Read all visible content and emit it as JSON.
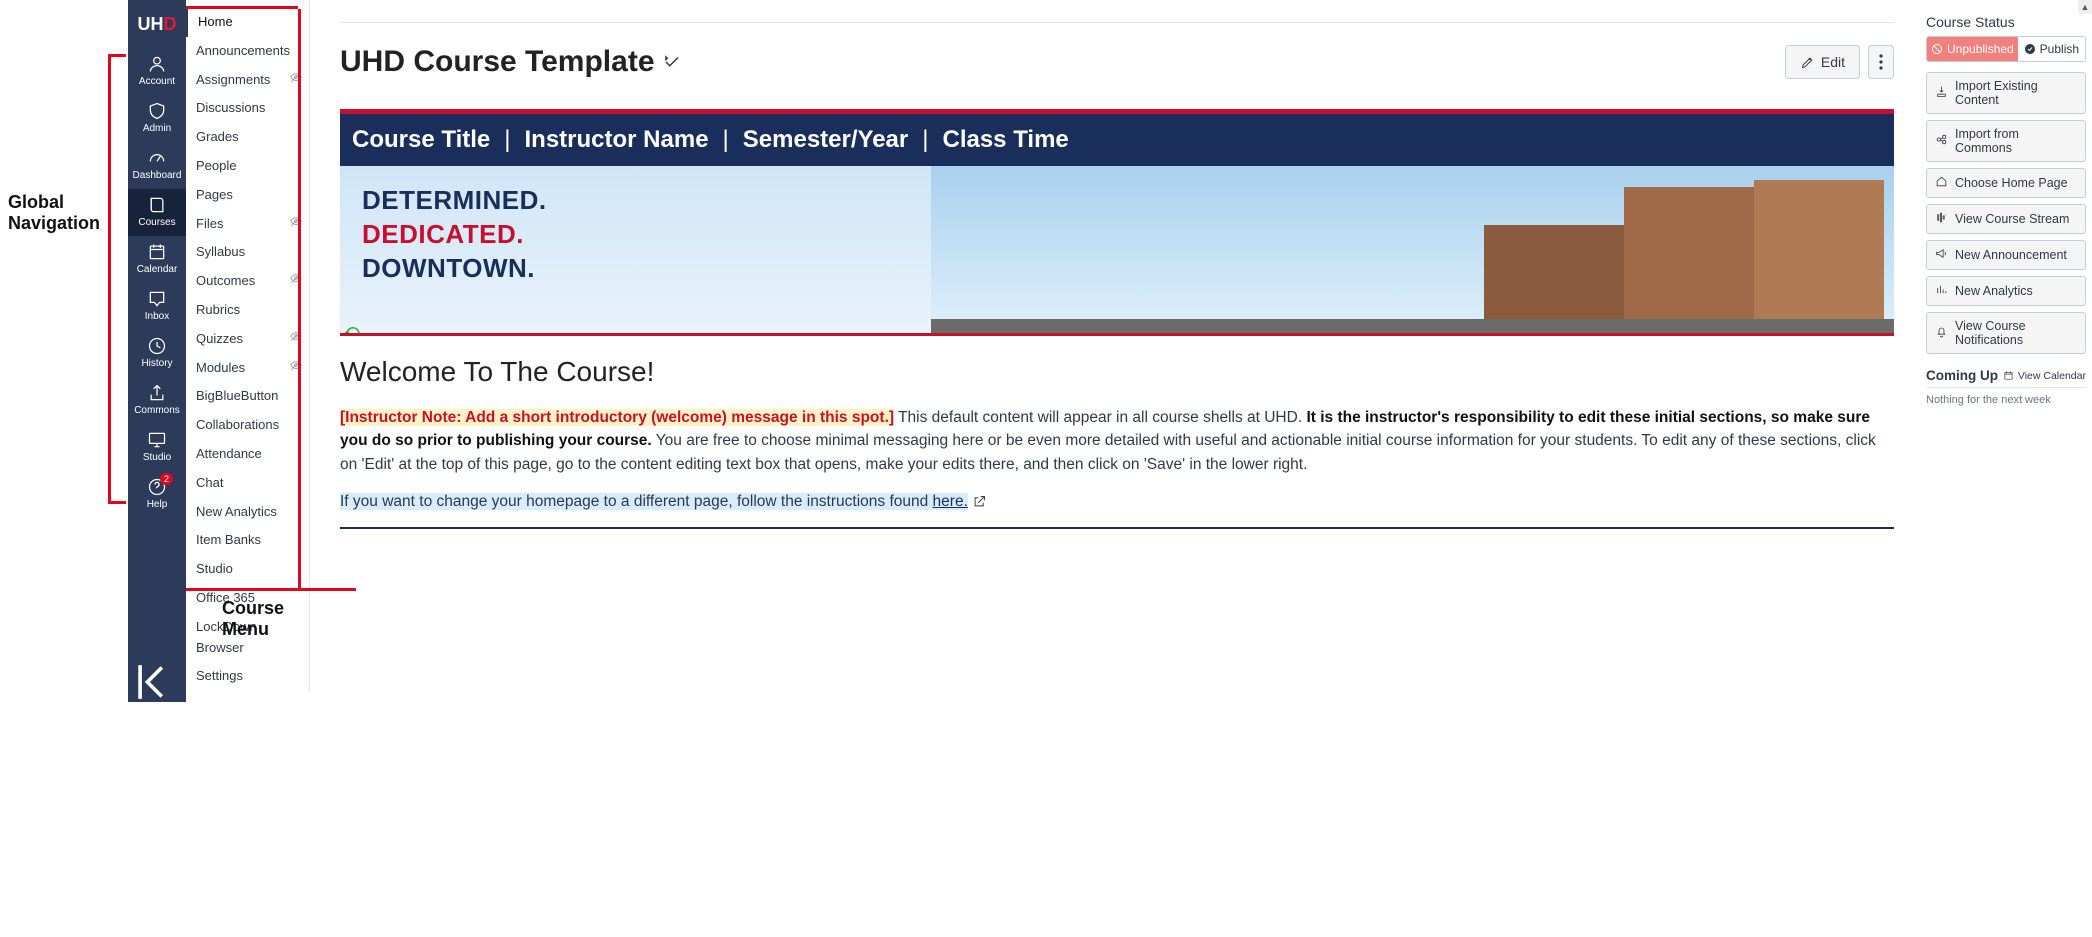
{
  "annotations": {
    "global_nav_label": "Global Navigation",
    "course_menu_label": "Course Menu"
  },
  "logo": {
    "prefix": "UH",
    "suffix": "D"
  },
  "global_nav": [
    {
      "id": "account",
      "label": "Account",
      "icon": "person-icon"
    },
    {
      "id": "admin",
      "label": "Admin",
      "icon": "shield-icon"
    },
    {
      "id": "dashboard",
      "label": "Dashboard",
      "icon": "gauge-icon"
    },
    {
      "id": "courses",
      "label": "Courses",
      "icon": "book-icon",
      "active": true
    },
    {
      "id": "calendar",
      "label": "Calendar",
      "icon": "calendar-icon"
    },
    {
      "id": "inbox",
      "label": "Inbox",
      "icon": "inbox-icon"
    },
    {
      "id": "history",
      "label": "History",
      "icon": "clock-icon"
    },
    {
      "id": "commons",
      "label": "Commons",
      "icon": "share-icon"
    },
    {
      "id": "studio",
      "label": "Studio",
      "icon": "monitor-icon"
    },
    {
      "id": "help",
      "label": "Help",
      "icon": "question-icon",
      "badge": "2"
    }
  ],
  "course_menu": [
    {
      "label": "Home",
      "selected": true
    },
    {
      "label": "Announcements"
    },
    {
      "label": "Assignments",
      "hidden": true
    },
    {
      "label": "Discussions"
    },
    {
      "label": "Grades"
    },
    {
      "label": "People"
    },
    {
      "label": "Pages"
    },
    {
      "label": "Files",
      "hidden": true
    },
    {
      "label": "Syllabus"
    },
    {
      "label": "Outcomes",
      "hidden": true
    },
    {
      "label": "Rubrics"
    },
    {
      "label": "Quizzes",
      "hidden": true
    },
    {
      "label": "Modules",
      "hidden": true
    },
    {
      "label": "BigBlueButton"
    },
    {
      "label": "Collaborations"
    },
    {
      "label": "Attendance"
    },
    {
      "label": "Chat"
    },
    {
      "label": "New Analytics"
    },
    {
      "label": "Item Banks"
    },
    {
      "label": "Studio"
    },
    {
      "label": "Office 365"
    },
    {
      "label": "LockDown Browser"
    },
    {
      "label": "Settings"
    }
  ],
  "page": {
    "title": "UHD Course Template",
    "edit_label": "Edit"
  },
  "banner": {
    "parts": [
      "Course Title",
      "Instructor Name",
      "Semester/Year",
      "Class Time"
    ],
    "hero_lines": [
      "DETERMINED.",
      "DEDICATED.",
      "DOWNTOWN."
    ]
  },
  "welcome": {
    "heading": "Welcome To The Course!",
    "note": "[Instructor Note: Add a short introductory (welcome) message in this spot.]",
    "p1a": " This default content will appear in all course shells at UHD. ",
    "bold": "It is the instructor's responsibility to edit these initial sections, so make sure you do so prior to publishing your course.",
    "p1b": " You are free to choose minimal messaging here or be even more detailed with useful and actionable initial course information for your students. To edit any of these sections, click on 'Edit' at the top of this page, go to the content editing text box that opens, make your edits there, and then click on 'Save' in the lower right.",
    "p2_prefix": "If you want to change your homepage to a different page, follow the instructions found ",
    "p2_link": "here."
  },
  "sidebar": {
    "status_title": "Course Status",
    "unpublished": "Unpublished",
    "publish": "Publish",
    "buttons": [
      "Import Existing Content",
      "Import from Commons",
      "Choose Home Page",
      "View Course Stream",
      "New Announcement",
      "New Analytics",
      "View Course Notifications"
    ],
    "coming_up": "Coming Up",
    "view_calendar": "View Calendar",
    "nothing": "Nothing for the next week"
  }
}
